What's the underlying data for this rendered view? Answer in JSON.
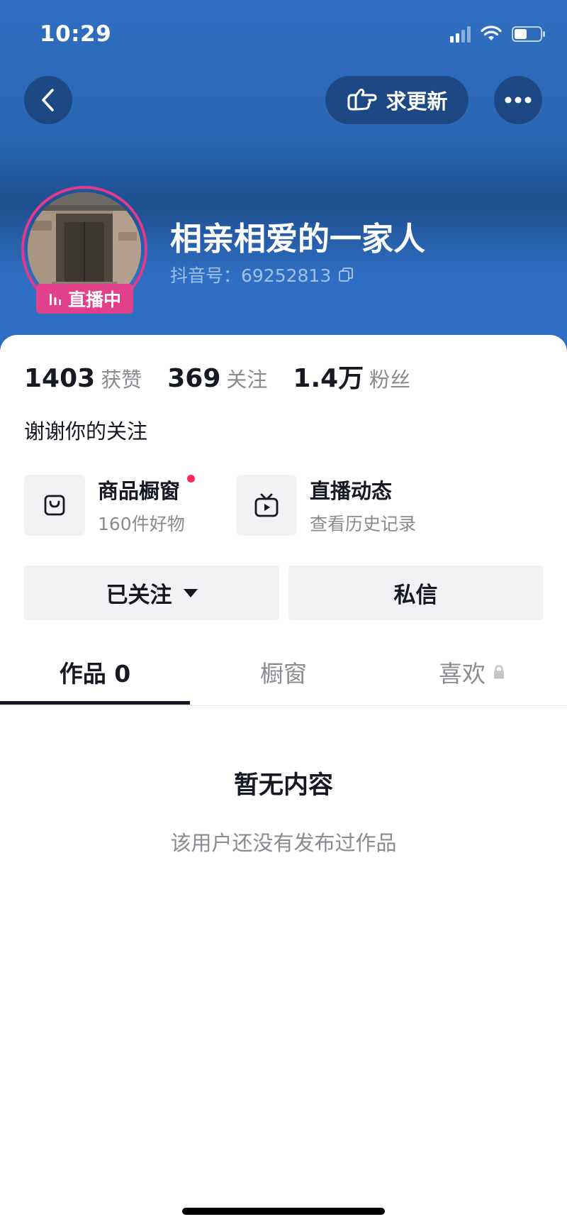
{
  "status_bar": {
    "time": "10:29"
  },
  "header": {
    "update_label": "求更新",
    "username": "相亲相爱的一家人",
    "douyin_id": "抖音号：69252813",
    "live_label": "直播中"
  },
  "stats": [
    {
      "num": "1403",
      "label": "获赞"
    },
    {
      "num": "369",
      "label": "关注"
    },
    {
      "num": "1.4万",
      "label": "粉丝"
    }
  ],
  "bio": "谢谢你的关注",
  "features": [
    {
      "title": "商品橱窗",
      "sub": "160件好物",
      "icon": "shopping-bag-icon",
      "has_dot": true
    },
    {
      "title": "直播动态",
      "sub": "查看历史记录",
      "icon": "tv-play-icon",
      "has_dot": false
    }
  ],
  "actions": {
    "following": "已关注",
    "message": "私信"
  },
  "tabs": [
    {
      "label": "作品 0",
      "active": true
    },
    {
      "label": "橱窗",
      "active": false
    },
    {
      "label": "喜欢",
      "active": false,
      "locked": true
    }
  ],
  "empty": {
    "title": "暂无内容",
    "subtitle": "该用户还没有发布过作品"
  },
  "colors": {
    "header_blue": "#2f6fc0",
    "live_pink": "#e0418a",
    "notify_red": "#fe2c55"
  }
}
